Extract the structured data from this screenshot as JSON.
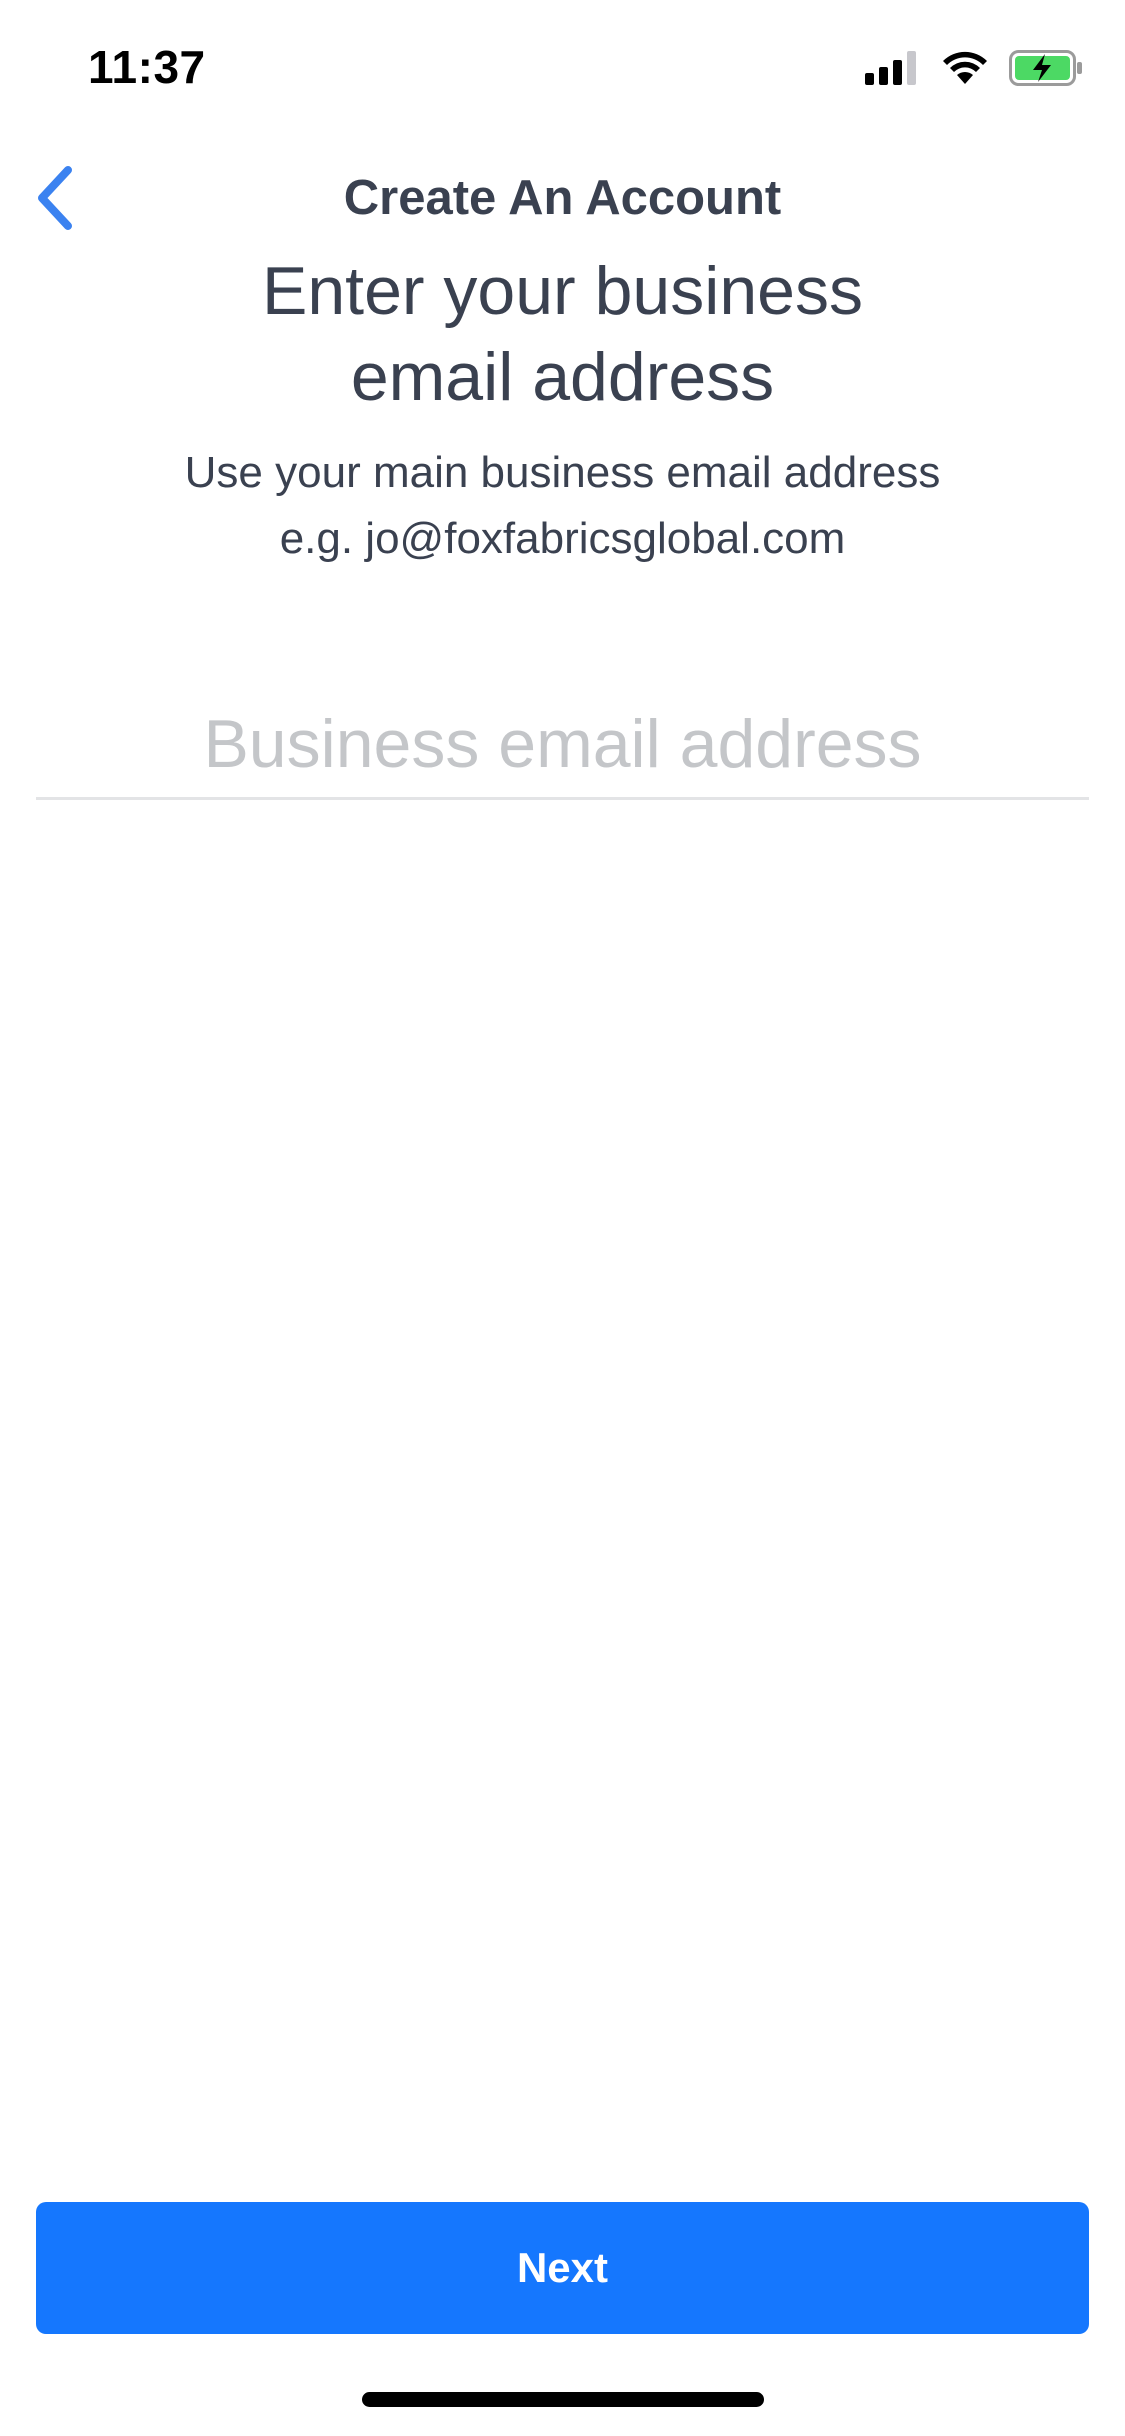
{
  "status_bar": {
    "time": "11:37",
    "icons": [
      "cellular-signal-icon",
      "wifi-icon",
      "battery-charging-icon"
    ],
    "battery_color": "#4cd964"
  },
  "nav": {
    "back_icon": "chevron-left-icon",
    "title": "Create An Account"
  },
  "heading": {
    "line1": "Enter your business",
    "line2": "email address"
  },
  "subheading": {
    "line1": "Use your main business email address",
    "line2": "e.g. jo@foxfabricsglobal.com"
  },
  "email_field": {
    "value": "",
    "placeholder": "Business email address"
  },
  "next_button": {
    "label": "Next"
  },
  "colors": {
    "accent": "#1577fe",
    "text": "#3a4150",
    "placeholder": "#c4c6c9",
    "back_chevron": "#3b82f0"
  }
}
